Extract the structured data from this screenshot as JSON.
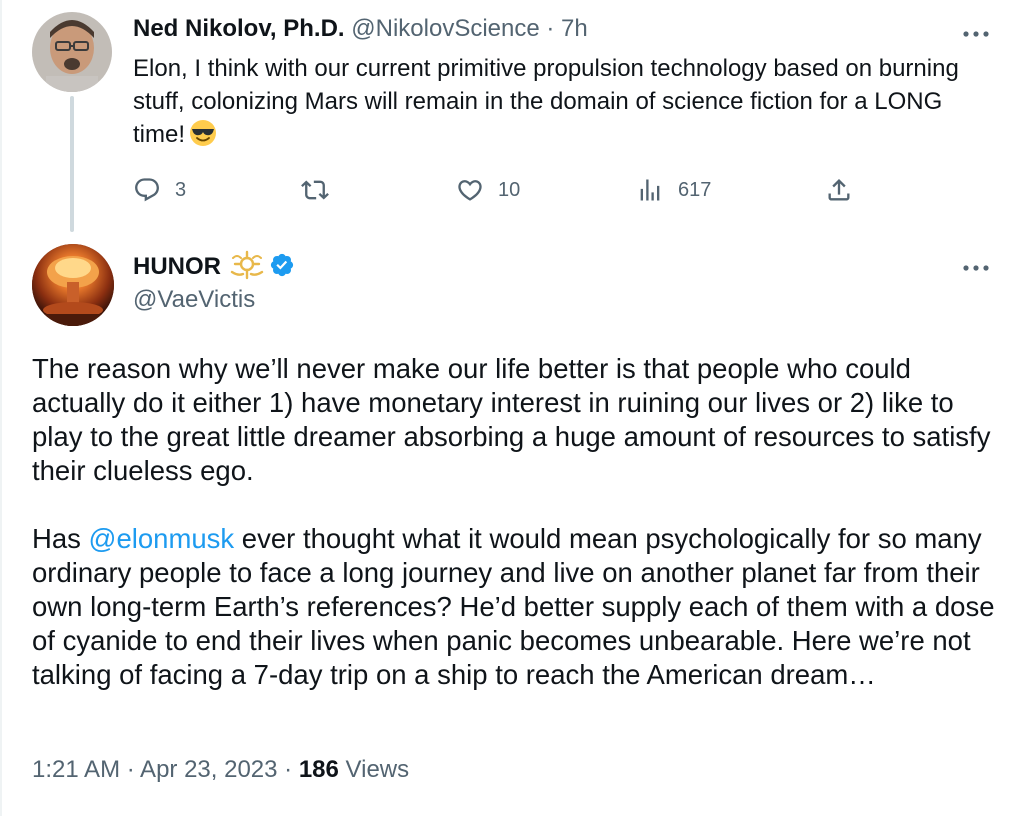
{
  "reply": {
    "author_name": "Ned Nikolov, Ph.D.",
    "handle": "@NikolovScience",
    "separator": "·",
    "time": "7h",
    "text": "Elon, I think with our current primitive propulsion technology based on burning stuff, colonizing Mars will remain in the domain of science fiction for a LONG time!",
    "emoji": "smiling-face-with-sunglasses-emoji",
    "actions": {
      "replies": "3",
      "retweets": "",
      "likes": "10",
      "views": "617"
    },
    "icons": [
      "more-icon",
      "reply-icon",
      "retweet-icon",
      "like-icon",
      "views-icon",
      "share-icon"
    ]
  },
  "main": {
    "author_name": "HUNOR",
    "handle": "@VaeVictis",
    "badge": "verified-icon",
    "crest": "crest-icon",
    "paragraph1": "The reason why we’ll never make our life better is that people who could actually do it either 1) have monetary interest in ruining our lives or 2) like to play to the great little dreamer absorbing a huge amount of resources to satisfy their clueless ego.",
    "paragraph2_prefix": "Has ",
    "mention": "@elonmusk",
    "paragraph2_suffix": " ever thought what it would mean psychologically for so many ordinary people to face a long journey and live on another planet far from their own long-term Earth’s references? He’d better supply each of them with a dose of cyanide to end their lives when panic becomes unbearable. Here we’re not talking of facing a 7-day trip on a ship to reach the American dream…",
    "timestamp": "1:21 AM · Apr 23, 2023 · ",
    "views_count": "186",
    "views_label": " Views"
  },
  "colors": {
    "text": "#0f1419",
    "secondary": "#536471",
    "accent": "#1d9bf0",
    "thread_line": "#cfd9de"
  }
}
